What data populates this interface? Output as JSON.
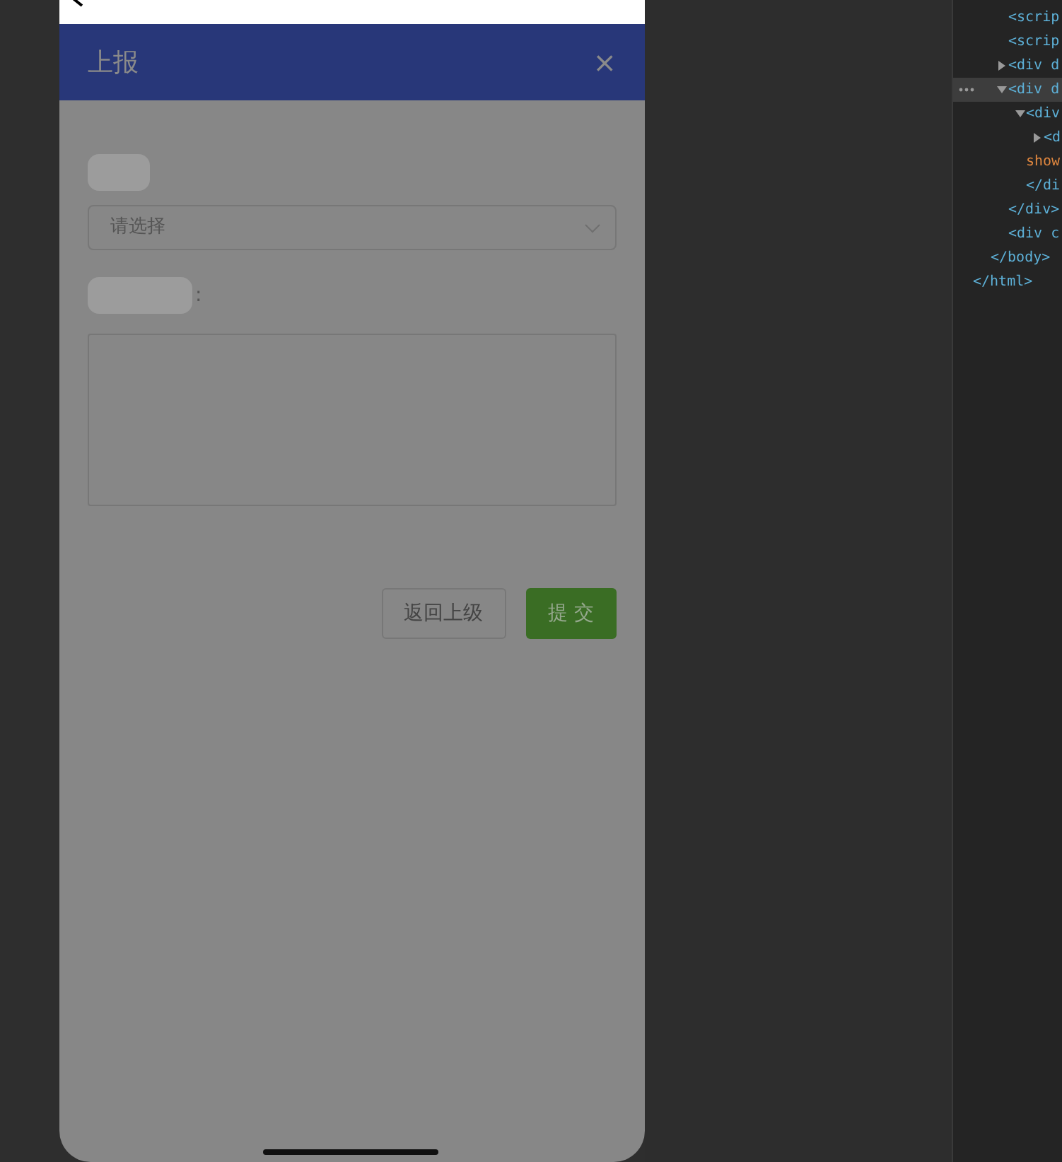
{
  "phone": {
    "dialog": {
      "title": "上报",
      "close": "×",
      "fields": [
        {
          "kind": "select",
          "placeholder": "请选择"
        },
        {
          "kind": "textarea",
          "label_suffix": ":"
        }
      ],
      "buttons": [
        {
          "label": "返回上级",
          "kind": "secondary"
        },
        {
          "label": "提 交",
          "kind": "primary"
        }
      ]
    }
  },
  "devtools": {
    "tree": [
      {
        "closing": "</html>",
        "children": [
          {
            "closing": "</body>",
            "children": [
              {
                "text": "<scrip",
                "selected": false
              },
              {
                "text": "<scrip",
                "selected": false
              },
              {
                "text": "<div d",
                "expanded": false,
                "selected": false
              },
              {
                "text": "<div d",
                "expanded": true,
                "selected": true,
                "closing": "</div>",
                "children": [
                  {
                    "text": "<div",
                    "expanded": true,
                    "selected": false,
                    "closing": "</di",
                    "children": [
                      {
                        "text": "<d",
                        "expanded": false,
                        "selected": false
                      },
                      {
                        "text": "show",
                        "kind": "attribute",
                        "selected": false
                      }
                    ]
                  }
                ]
              },
              {
                "text": "<div c",
                "selected": false
              }
            ]
          }
        ]
      }
    ]
  }
}
